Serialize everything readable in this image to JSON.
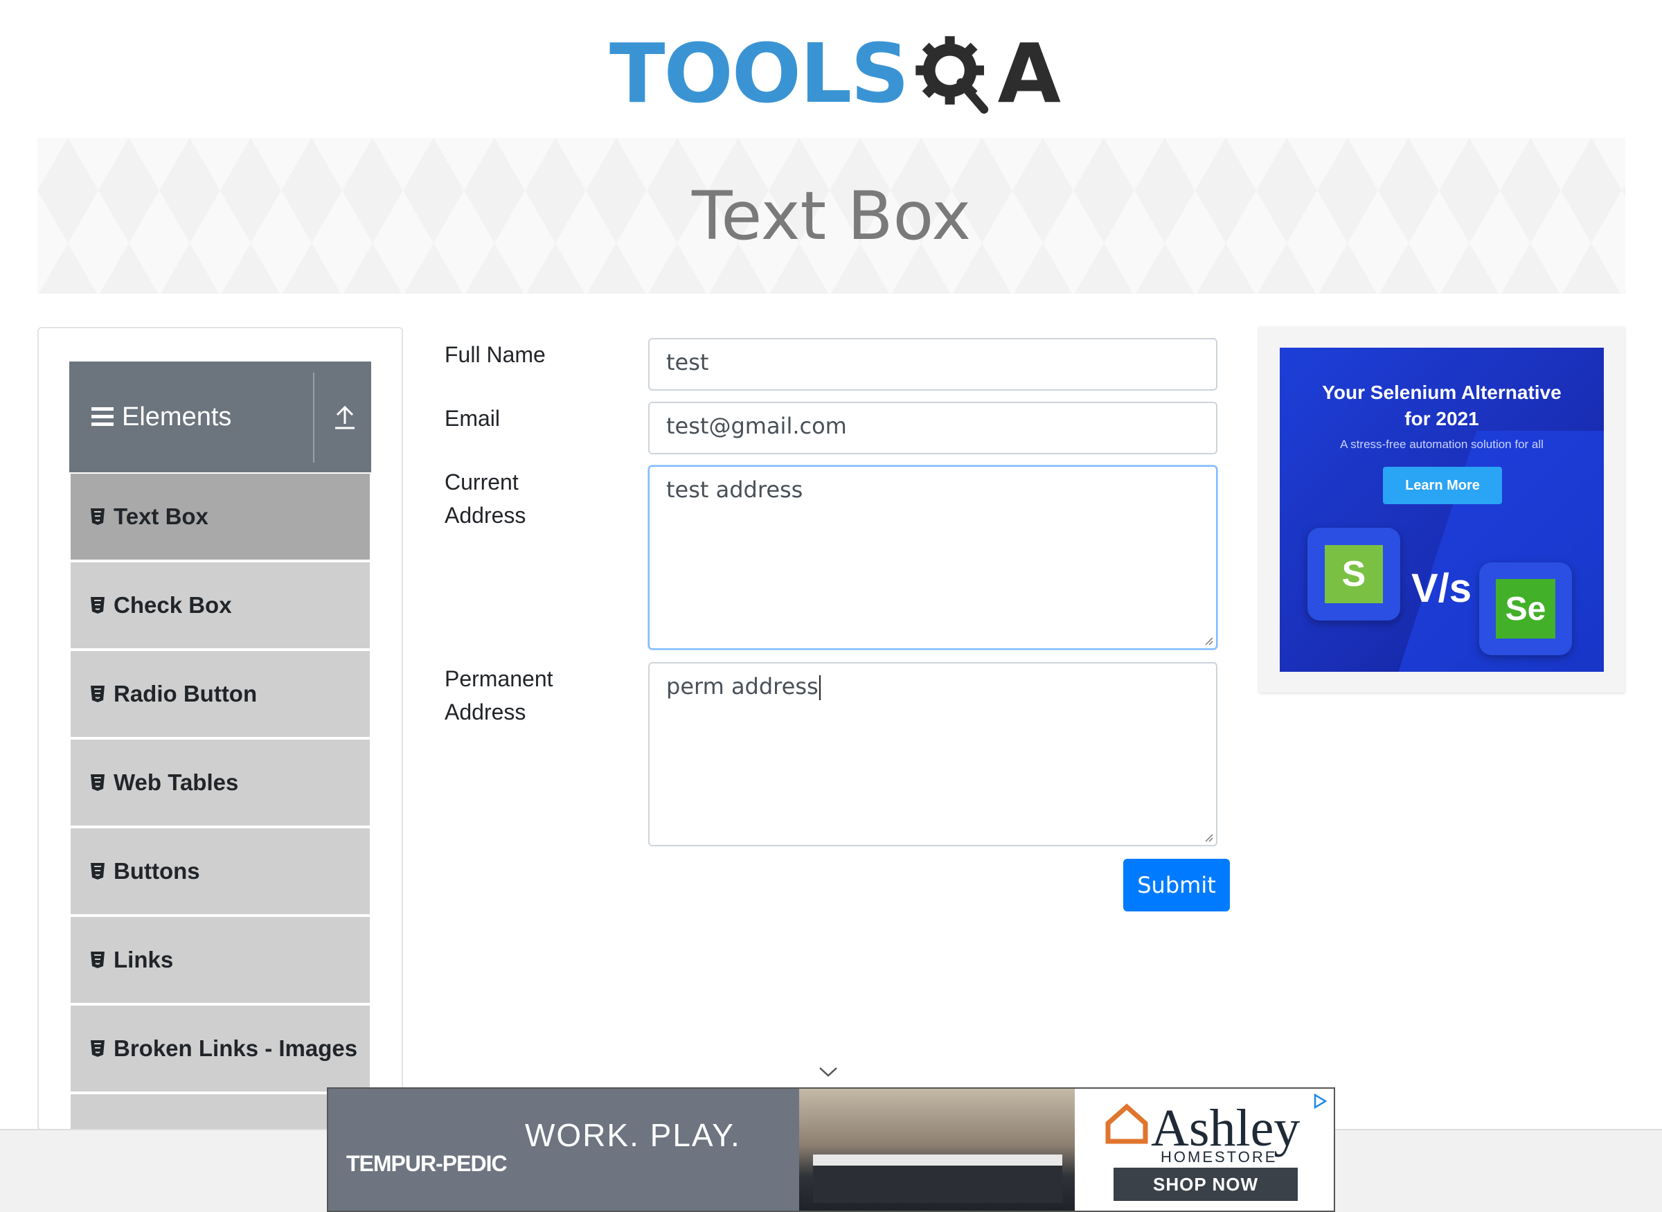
{
  "logo": {
    "part1": "TOOLS",
    "part2": "A"
  },
  "banner": {
    "title": "Text Box"
  },
  "sidebar": {
    "group_title": "Elements",
    "items": [
      {
        "label": "Text Box"
      },
      {
        "label": "Check Box"
      },
      {
        "label": "Radio Button"
      },
      {
        "label": "Web Tables"
      },
      {
        "label": "Buttons"
      },
      {
        "label": "Links"
      },
      {
        "label": "Broken Links - Images"
      }
    ]
  },
  "form": {
    "full_name": {
      "label": "Full Name",
      "value": "test"
    },
    "email": {
      "label": "Email",
      "value": "test@gmail.com"
    },
    "current_address": {
      "label_line1": "Current",
      "label_line2": "Address",
      "value": "test address"
    },
    "permanent_address": {
      "label_line1": "Permanent",
      "label_line2": "Address",
      "value": "perm address"
    },
    "submit_label": "Submit"
  },
  "side_ad": {
    "headline_line1": "Your Selenium Alternative",
    "headline_line2": "for 2021",
    "subtext": "A stress-free automation solution for all",
    "button_label": "Learn More",
    "vs_text": "V/s",
    "left_tile_letter": "S",
    "right_tile_letter": "Se"
  },
  "bottom_ad": {
    "brand": "TEMPUR-PEDIC",
    "tagline": "WORK. PLAY.",
    "advertiser": "Ashley",
    "advertiser_sub": "HOMESTORE",
    "cta": "SHOP NOW"
  },
  "colors": {
    "logo_blue": "#3a94d4",
    "logo_dark": "#2d2d2d",
    "group_header": "#6c757d",
    "menu_item": "#cfcfcf",
    "menu_item_active": "#a9a9a9",
    "submit": "#007bff"
  },
  "icons": {
    "menu": "hamburger-icon",
    "collapse": "upload-arrow-icon",
    "item": "html5-shield-icon",
    "scroll": "chevron-down-icon",
    "ad_choices": "adchoices-icon"
  }
}
